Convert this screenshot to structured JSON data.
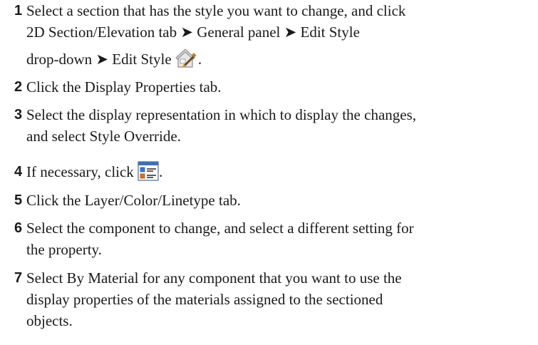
{
  "steps": [
    {
      "num": "1",
      "line1": "Select a section that has the style you want to change, and click",
      "line2": "2D Section/Elevation tab ➤ General panel ➤ Edit Style",
      "line3_text": "drop-down ➤ Edit Style",
      "line3_end": ".",
      "icon": "edit-style-icon"
    },
    {
      "num": "2",
      "line1": "Click the Display Properties tab."
    },
    {
      "num": "3",
      "line1": "Select the display representation in which to display the changes,",
      "line2": "and select Style Override."
    },
    {
      "num": "4",
      "line1_text": "If necessary, click",
      "line1_end": ".",
      "icon": "display-properties-icon"
    },
    {
      "num": "5",
      "line1": "Click the Layer/Color/Linetype tab."
    },
    {
      "num": "6",
      "line1": "Select the component to change, and select a different setting for",
      "line2": "the property."
    },
    {
      "num": "7",
      "line1": "Select By Material for any component that you want to use the",
      "line2": "display properties of the materials assigned to the sectioned",
      "line3": "objects."
    }
  ]
}
